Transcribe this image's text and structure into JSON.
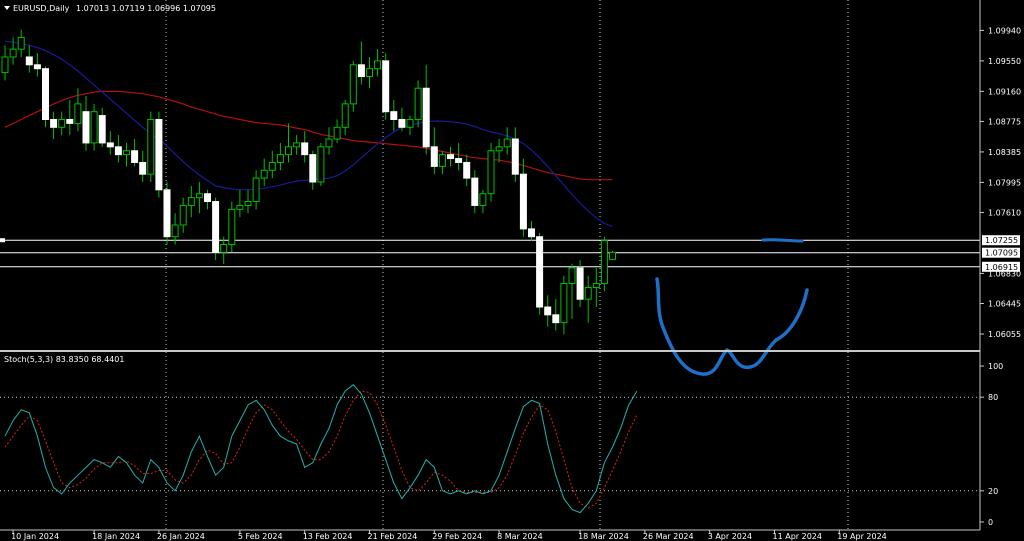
{
  "header": {
    "symbol": "EURUSD,Daily",
    "ohlc": "1.07013 1.07119 1.06996 1.07095"
  },
  "indicator": {
    "label": "Stoch(5,3,3) 83.8350 68.4401",
    "levels": [
      "100",
      "80",
      "20",
      "0"
    ],
    "level_values": [
      100,
      80,
      20,
      0
    ]
  },
  "colors": {
    "background": "#000000",
    "bull_candle": "#000000",
    "bear_candle": "#ffffff",
    "wick": "#00c000",
    "ma_fast": "#1a1a9c",
    "ma_slow": "#b01010",
    "stoch_main": "#20b2aa",
    "stoch_signal": "#e02020",
    "annotation": "#1e6fc8",
    "grid": "#c8c8c8"
  },
  "chart_data": {
    "type": "candlestick",
    "symbol": "EURUSD",
    "timeframe": "Daily",
    "ylim": [
      1.0585,
      1.1015
    ],
    "yticks": [
      1.0994,
      1.0955,
      1.0916,
      1.08775,
      1.08385,
      1.07995,
      1.0761,
      1.0683,
      1.06445,
      1.06055
    ],
    "ytick_labels": [
      "1.09940",
      "1.09550",
      "1.09160",
      "1.08775",
      "1.08385",
      "1.07995",
      "1.07610",
      "1.06830",
      "1.06445",
      "1.06055"
    ],
    "price_lines": [
      {
        "label": "1.07255",
        "value": 1.07255
      },
      {
        "label": "1.07095",
        "value": 1.07095
      },
      {
        "label": "1.06915",
        "value": 1.06915
      }
    ],
    "xtick_labels": [
      "10 Jan 2024",
      "18 Jan 2024",
      "26 Jan 2024",
      "5 Feb 2024",
      "13 Feb 2024",
      "21 Feb 2024",
      "29 Feb 2024",
      "8 Mar 2024",
      "18 Mar 2024",
      "26 Mar 2024",
      "3 Apr 2024",
      "11 Apr 2024",
      "19 Apr 2024"
    ],
    "xtick_index": [
      1,
      11,
      19,
      29,
      37,
      45,
      53,
      61,
      71,
      79,
      87,
      95,
      103
    ],
    "candles": [
      [
        1.094,
        1.0975,
        1.093,
        1.096
      ],
      [
        1.096,
        1.0985,
        1.095,
        1.097
      ],
      [
        1.097,
        1.0995,
        1.096,
        1.0985
      ],
      [
        1.096,
        1.0975,
        1.094,
        1.095
      ],
      [
        1.095,
        1.0965,
        1.0935,
        1.0945
      ],
      [
        1.0945,
        1.0948,
        1.087,
        1.088
      ],
      [
        1.088,
        1.089,
        1.0855,
        1.087
      ],
      [
        1.087,
        1.089,
        1.086,
        1.088
      ],
      [
        1.088,
        1.0905,
        1.086,
        1.0875
      ],
      [
        1.0875,
        1.092,
        1.0865,
        1.09
      ],
      [
        1.089,
        1.091,
        1.084,
        1.085
      ],
      [
        1.085,
        1.09,
        1.084,
        1.089
      ],
      [
        1.0885,
        1.0895,
        1.0845,
        1.085
      ],
      [
        1.085,
        1.0865,
        1.0835,
        1.0845
      ],
      [
        1.0845,
        1.086,
        1.0825,
        1.0835
      ],
      [
        1.0835,
        1.085,
        1.082,
        1.084
      ],
      [
        1.084,
        1.0855,
        1.082,
        1.0825
      ],
      [
        1.0825,
        1.084,
        1.08,
        1.081
      ],
      [
        1.081,
        1.089,
        1.08,
        1.088
      ],
      [
        1.088,
        1.089,
        1.078,
        1.079
      ],
      [
        1.079,
        1.08,
        1.072,
        1.073
      ],
      [
        1.073,
        1.076,
        1.072,
        1.0745
      ],
      [
        1.0745,
        1.078,
        1.0735,
        1.077
      ],
      [
        1.077,
        1.0795,
        1.0755,
        1.078
      ],
      [
        1.078,
        1.08,
        1.076,
        1.0785
      ],
      [
        1.0785,
        1.079,
        1.0765,
        1.0775
      ],
      [
        1.0775,
        1.078,
        1.07,
        1.071
      ],
      [
        1.071,
        1.073,
        1.0695,
        1.072
      ],
      [
        1.072,
        1.0775,
        1.071,
        1.0765
      ],
      [
        1.0765,
        1.079,
        1.0755,
        1.077
      ],
      [
        1.077,
        1.079,
        1.076,
        1.0775
      ],
      [
        1.0775,
        1.0815,
        1.0765,
        1.0805
      ],
      [
        1.0805,
        1.083,
        1.0795,
        1.0815
      ],
      [
        1.0815,
        1.084,
        1.0805,
        1.0825
      ],
      [
        1.0825,
        1.085,
        1.0815,
        1.0835
      ],
      [
        1.0835,
        1.0875,
        1.0825,
        1.0845
      ],
      [
        1.0845,
        1.086,
        1.0835,
        1.085
      ],
      [
        1.085,
        1.0865,
        1.0825,
        1.0835
      ],
      [
        1.0835,
        1.084,
        1.079,
        1.08
      ],
      [
        1.08,
        1.085,
        1.0795,
        1.0845
      ],
      [
        1.0845,
        1.087,
        1.0835,
        1.0855
      ],
      [
        1.0855,
        1.088,
        1.085,
        1.087
      ],
      [
        1.087,
        1.0905,
        1.086,
        1.09
      ],
      [
        1.09,
        1.0955,
        1.089,
        1.095
      ],
      [
        1.095,
        1.098,
        1.0925,
        1.0935
      ],
      [
        1.0935,
        1.096,
        1.092,
        1.0945
      ],
      [
        1.0945,
        1.097,
        1.0935,
        1.0955
      ],
      [
        1.0955,
        1.0965,
        1.088,
        1.089
      ],
      [
        1.089,
        1.0905,
        1.0865,
        1.088
      ],
      [
        1.088,
        1.0895,
        1.0865,
        1.087
      ],
      [
        1.087,
        1.0885,
        1.086,
        1.088
      ],
      [
        1.088,
        1.093,
        1.087,
        1.092
      ],
      [
        1.092,
        1.095,
        1.0835,
        1.0845
      ],
      [
        1.0845,
        1.087,
        1.081,
        1.082
      ],
      [
        1.082,
        1.084,
        1.081,
        1.0835
      ],
      [
        1.0835,
        1.0845,
        1.082,
        1.083
      ],
      [
        1.083,
        1.085,
        1.0815,
        1.0825
      ],
      [
        1.0825,
        1.0835,
        1.0795,
        1.0805
      ],
      [
        1.0805,
        1.0815,
        1.076,
        1.077
      ],
      [
        1.077,
        1.079,
        1.076,
        1.0785
      ],
      [
        1.0785,
        1.085,
        1.0775,
        1.084
      ],
      [
        1.084,
        1.0855,
        1.0825,
        1.0845
      ],
      [
        1.0845,
        1.087,
        1.0835,
        1.0855
      ],
      [
        1.0855,
        1.087,
        1.08,
        1.081
      ],
      [
        1.081,
        1.083,
        1.073,
        1.074
      ],
      [
        1.074,
        1.075,
        1.0725,
        1.073
      ],
      [
        1.073,
        1.0735,
        1.063,
        1.064
      ],
      [
        1.064,
        1.0655,
        1.0615,
        1.063
      ],
      [
        1.063,
        1.065,
        1.061,
        1.062
      ],
      [
        1.062,
        1.068,
        1.0605,
        1.067
      ],
      [
        1.067,
        1.0695,
        1.0625,
        1.069
      ],
      [
        1.069,
        1.07,
        1.064,
        1.065
      ],
      [
        1.065,
        1.068,
        1.062,
        1.0665
      ],
      [
        1.0665,
        1.069,
        1.064,
        1.067
      ],
      [
        1.067,
        1.073,
        1.066,
        1.0725
      ],
      [
        1.0701,
        1.0712,
        1.07,
        1.071
      ]
    ],
    "ma_fast": [
      1.098,
      1.0979,
      1.0977,
      1.0975,
      1.0972,
      1.0968,
      1.0963,
      1.0957,
      1.095,
      1.0942,
      1.0933,
      1.0924,
      1.0915,
      1.0906,
      1.0897,
      1.0888,
      1.0879,
      1.087,
      1.0862,
      1.0855,
      1.0846,
      1.0836,
      1.0826,
      1.0817,
      1.0809,
      1.0802,
      1.0795,
      1.0793,
      1.0791,
      1.079,
      1.079,
      1.0791,
      1.0792,
      1.0794,
      1.0796,
      1.0799,
      1.0801,
      1.0802,
      1.0803,
      1.0804,
      1.0805,
      1.0808,
      1.0814,
      1.0822,
      1.0831,
      1.084,
      1.0849,
      1.0857,
      1.0864,
      1.087,
      1.0873,
      1.0875,
      1.0877,
      1.0878,
      1.0878,
      1.0877,
      1.0876,
      1.0874,
      1.0871,
      1.0867,
      1.0864,
      1.0862,
      1.0859,
      1.0855,
      1.0849,
      1.0841,
      1.0831,
      1.082,
      1.0808,
      1.0796,
      1.0784,
      1.0773,
      1.0763,
      1.0754,
      1.0747,
      1.0743
    ],
    "ma_fast_start": 0,
    "ma_slow": [
      1.087,
      1.0875,
      1.088,
      1.0885,
      1.089,
      1.0895,
      1.09,
      1.0904,
      1.0908,
      1.0911,
      1.0913,
      1.0915,
      1.0916,
      1.0916,
      1.0916,
      1.0915,
      1.0914,
      1.0913,
      1.0911,
      1.0909,
      1.0906,
      1.0903,
      1.09,
      1.0896,
      1.0893,
      1.089,
      1.0887,
      1.0884,
      1.0882,
      1.088,
      1.0878,
      1.0876,
      1.0875,
      1.0874,
      1.0873,
      1.0871,
      1.0869,
      1.0867,
      1.0864,
      1.0861,
      1.0859,
      1.0857,
      1.0855,
      1.0853,
      1.0852,
      1.0851,
      1.085,
      1.0849,
      1.0848,
      1.0847,
      1.0846,
      1.0845,
      1.0843,
      1.0841,
      1.0839,
      1.0837,
      1.0835,
      1.0833,
      1.0831,
      1.083,
      1.0829,
      1.0828,
      1.0826,
      1.0824,
      1.0821,
      1.0818,
      1.0815,
      1.0812,
      1.081,
      1.0808,
      1.0806,
      1.0804,
      1.0803,
      1.0803,
      1.0803,
      1.0803
    ],
    "stoch_main": [
      55,
      65,
      72,
      70,
      55,
      35,
      22,
      18,
      25,
      30,
      35,
      40,
      38,
      35,
      42,
      38,
      30,
      25,
      40,
      35,
      25,
      20,
      30,
      45,
      55,
      42,
      30,
      35,
      55,
      65,
      75,
      78,
      72,
      62,
      55,
      52,
      50,
      35,
      38,
      50,
      60,
      75,
      84,
      88,
      82,
      70,
      55,
      40,
      25,
      15,
      22,
      30,
      40,
      35,
      20,
      18,
      20,
      18,
      20,
      18,
      20,
      30,
      45,
      60,
      74,
      78,
      76,
      50,
      30,
      15,
      8,
      6,
      12,
      20,
      38,
      48,
      60,
      75,
      83.8
    ],
    "stoch_signal": [
      48,
      55,
      62,
      68,
      65,
      52,
      38,
      25,
      22,
      24,
      28,
      34,
      38,
      38,
      38,
      39,
      36,
      31,
      31,
      33,
      33,
      27,
      25,
      30,
      40,
      46,
      44,
      37,
      38,
      48,
      60,
      70,
      75,
      72,
      65,
      58,
      53,
      46,
      40,
      40,
      45,
      55,
      68,
      78,
      84,
      83,
      75,
      62,
      48,
      33,
      22,
      20,
      25,
      32,
      30,
      26,
      20,
      19,
      19,
      19,
      19,
      22,
      30,
      43,
      57,
      67,
      75,
      72,
      58,
      40,
      22,
      12,
      9,
      12,
      22,
      33,
      45,
      58,
      68.4
    ]
  }
}
